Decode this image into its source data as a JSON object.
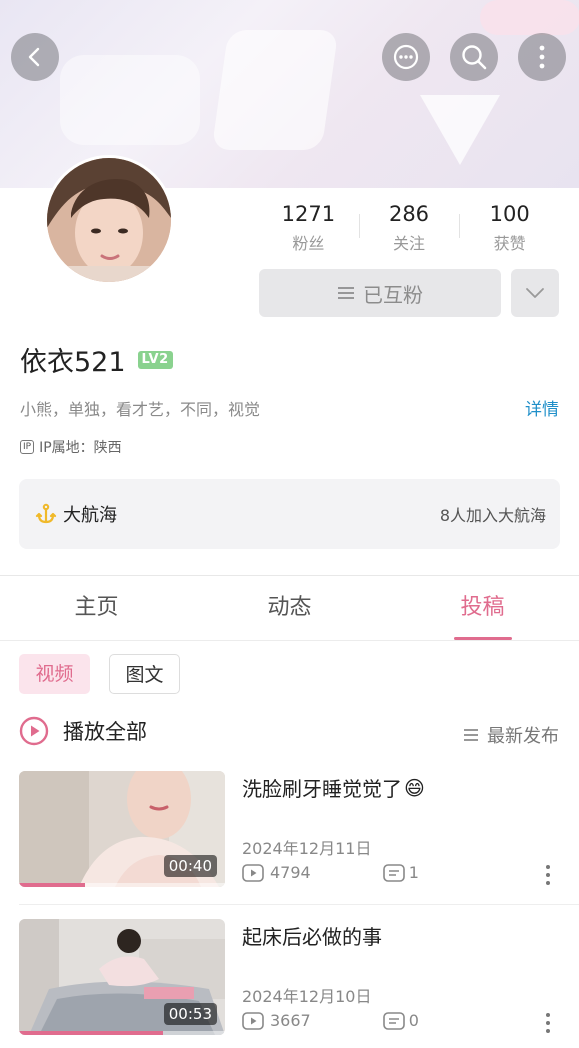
{
  "header": {
    "back_icon": "chevron-left-icon",
    "actions": [
      "message-icon",
      "search-icon",
      "more-vertical-icon"
    ]
  },
  "profile": {
    "stats": [
      {
        "value": "1271",
        "label": "粉丝"
      },
      {
        "value": "286",
        "label": "关注"
      },
      {
        "value": "100",
        "label": "获赞"
      }
    ],
    "follow_button": "已互粉",
    "name": "依衣521",
    "level": "LV2",
    "signature": "小熊，单独，看才艺，不同，视觉",
    "detail_link": "详情",
    "ip_badge": "IP",
    "ip_location": "IP属地：陕西"
  },
  "guard": {
    "label": "大航海",
    "count_text": "8人加入大航海"
  },
  "tabs": [
    {
      "label": "主页",
      "active": false
    },
    {
      "label": "动态",
      "active": false
    },
    {
      "label": "投稿",
      "active": true
    }
  ],
  "filters": [
    {
      "label": "视频",
      "active": true
    },
    {
      "label": "图文",
      "active": false
    }
  ],
  "play_all": "播放全部",
  "sort": "最新发布",
  "videos": [
    {
      "title": "洗脸刷牙睡觉觉了",
      "emoji": "😄",
      "date": "2024年12月11日",
      "views": "4794",
      "comments": "1",
      "duration": "00:40",
      "progress": 0.32
    },
    {
      "title": "起床后必做的事",
      "emoji": "",
      "date": "2024年12月10日",
      "views": "3667",
      "comments": "0",
      "duration": "00:53",
      "progress": 0.7
    }
  ],
  "colors": {
    "accent": "#e06c8e",
    "link": "#1f8fc9",
    "level": "#8ad28f",
    "guard_icon": "#f0b92a"
  }
}
